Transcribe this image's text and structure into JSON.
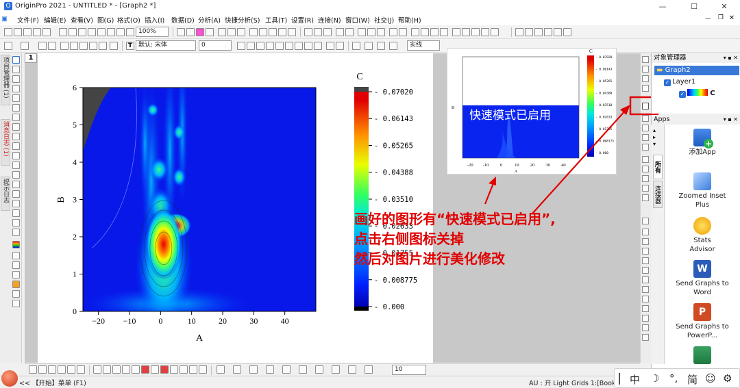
{
  "window": {
    "title": "OriginPro 2021 - UNTITLED * - [Graph2 *]",
    "controls": {
      "minimize": "—",
      "maximize": "☐",
      "close": "✕"
    }
  },
  "menu": {
    "items": [
      "文件(F)",
      "编辑(E)",
      "查看(V)",
      "图(G)",
      "格式(O)",
      "插入(I)",
      "数据(D)",
      "分析(A)",
      "快捷分析(S)",
      "工具(T)",
      "设置(R)",
      "连接(N)",
      "窗口(W)",
      "社交(J)",
      "帮助(H)"
    ],
    "window_controls": {
      "minimize": "—",
      "restore": "❐",
      "close": "✕"
    }
  },
  "toolbar": {
    "zoom": "100%",
    "font_name": "默认: 宋体",
    "font_size": "0",
    "line_style": "实线",
    "bottom_size": "10"
  },
  "page_number": "1",
  "graph": {
    "xlabel": "A",
    "ylabel": "B",
    "xticks": [
      "−20",
      "−10",
      "0",
      "10",
      "20",
      "30",
      "40"
    ],
    "yticks": [
      "0",
      "1",
      "2",
      "3",
      "4",
      "5",
      "6"
    ],
    "colorbar_title": "C",
    "colorbar_labels": [
      "0.07020",
      "0.06143",
      "0.05265",
      "0.04388",
      "0.03510",
      "0.02633",
      "0.01755",
      "0.008775",
      "0.000"
    ]
  },
  "chart_data": {
    "type": "heatmap",
    "title": "",
    "xlabel": "A",
    "ylabel": "B",
    "xlim": [
      -25,
      50
    ],
    "ylim": [
      0,
      6
    ],
    "zlabel": "C",
    "zlim": [
      0,
      0.0702
    ],
    "colorbar_ticks": [
      0.0702,
      0.06143,
      0.05265,
      0.04388,
      0.0351,
      0.02633,
      0.01755,
      0.008775,
      0.0
    ],
    "peak": {
      "x": 1,
      "y": 1.8,
      "value": 0.0702
    },
    "colors": [
      "#0000a0",
      "#0030ff",
      "#00b0ff",
      "#30ff90",
      "#e8ff00",
      "#ff9000",
      "#e80000",
      "#444444"
    ]
  },
  "mini_preview": {
    "overlay_text": "快速模式已启用",
    "xticks": [
      "-20",
      "-10",
      "0",
      "10",
      "20",
      "30",
      "40"
    ],
    "xlabel": "A",
    "ylabel": "B",
    "colorbar_title": "C",
    "colorbar_labels": [
      "0.07020",
      "0.06143",
      "0.05265",
      "0.04388",
      "0.03510",
      "0.02633",
      "0.01755",
      "0.008775",
      "0.000"
    ]
  },
  "annotation": {
    "line1": "画好的图形有“快速模式已启用”,",
    "line2": "点击右侧图标关掉",
    "line3": "然后对图片进行美化修改",
    "color": "#e00000"
  },
  "left_vertical_tabs": [
    "项目管理器 (1)",
    "消息日志 (1)",
    "提示日志"
  ],
  "object_manager": {
    "title": "对象管理器",
    "graph": "Graph2",
    "layer": "Layer1",
    "plot": "C"
  },
  "apps": {
    "title": "Apps",
    "tabs": [
      "所有",
      "连接器"
    ],
    "items": [
      "添加App",
      "Zoomed Inset Plus",
      "Stats Advisor",
      "Send Graphs to Word",
      "Send Graphs to PowerP..."
    ]
  },
  "status": {
    "left": "<< 【开始】菜单 (F1)",
    "right": "AU : 开 Light Grids 1:[Book2]"
  },
  "ime": {
    "items": [
      "中",
      "☽",
      "°,",
      "简",
      "☺",
      "⚙"
    ]
  }
}
